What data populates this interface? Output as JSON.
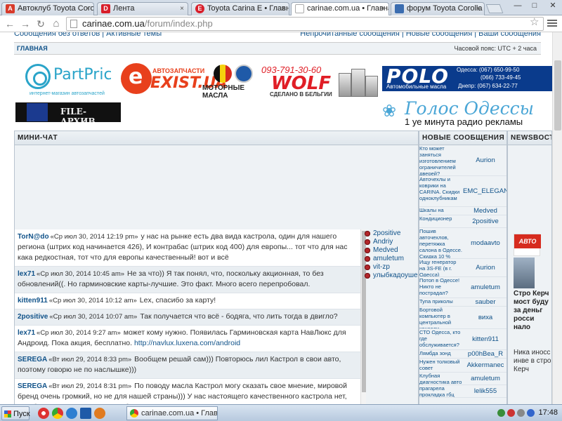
{
  "browser": {
    "tabs": [
      {
        "label": "Автоклуб Toyota Coron",
        "icon_color": "#d83b2b",
        "icon_glyph": "A",
        "active": false
      },
      {
        "label": "Лента",
        "icon_color": "#d81e2a",
        "icon_glyph": "D",
        "active": false
      },
      {
        "label": "Toyota Carina E • Главн",
        "icon_color": "#d81e2a",
        "icon_glyph": "E",
        "active": false
      },
      {
        "label": "carinae.com.ua • Главна",
        "icon_color": "#ffffff",
        "icon_glyph": "",
        "active": true
      },
      {
        "label": "форум Toyota Corolla",
        "icon_color": "#3b6db0",
        "icon_glyph": "",
        "active": false
      }
    ],
    "url_host": "carinae.com.ua",
    "url_path": "/forum/index.php",
    "window_min": "—",
    "window_max": "□",
    "window_close": "✕",
    "tab_close": "×"
  },
  "page": {
    "top_left_links": "Сообщения без ответов | Активные темы",
    "top_right_links": "Непрочитанные сообщения | Новые сообщения | Ваши сообщения",
    "nav_home": "ГЛАВНАЯ",
    "timezone": "Часовой пояс: UTC + 2 часа"
  },
  "banners": {
    "partprice_name": "PartPrice",
    "partprice_tag": "интернет-магазин автозапчастей",
    "exist_sub": "АВТОЗАПЧАСТИ",
    "exist_name": "EXIST.UA",
    "exist_oil": "МОТОРНЫЕ МАСЛА",
    "wolf_phone": "093-791-30-60",
    "wolf_name": "WOLF",
    "wolf_made": "СДЕЛАНО В БЕЛЬГИИ",
    "polo_name": "POLO",
    "polo_tag": "Автомобильные масла",
    "polo_phones": [
      "Одесса: (067) 650-99-50",
      "(066) 733-49-45",
      "Днепр: (067) 634-22-77"
    ],
    "file_archive": "FILE-АРХИВ",
    "golos_title": "Голос Одессы",
    "golos_sub": "1 уе минута радио рекламы"
  },
  "minichat": {
    "header": "МИНИ-ЧАТ",
    "messages": [
      {
        "user": "TorN@do",
        "date": "«Ср июл 30, 2014 12:19 pm»",
        "text": "у нас на рынке есть два вида кастрола, один для нашего региона (штрих код начинается 426), И контрабас (штрих код 400) для европы... тот что для нас кака редкостная, тот что для европы качественный! вот и всё"
      },
      {
        "user": "lex71",
        "date": "«Ср июл 30, 2014 10:45 am»",
        "text": "Не за что)) Я так понял, что, поскольку акционная, то без обновлений((. Но гарминовские карты-лучшие. Это факт. Много всего перепробовал."
      },
      {
        "user": "kitten911",
        "date": "«Ср июл 30, 2014 10:12 am»",
        "text": "Lex, спасибо за карту!"
      },
      {
        "user": "2positive",
        "date": "«Ср июл 30, 2014 10:07 am»",
        "text": "Так получается что всё - бодяга, что лить тогда в двигло?"
      },
      {
        "user": "lex71",
        "date": "«Ср июл 30, 2014 9:27 am»",
        "text": "может кому нужно. Появилась Гарминовская карта НавЛюкс для Андроид. Пока акция, бесплатно.",
        "link": "http://navlux.luxena.com/android"
      },
      {
        "user": "SEREGA",
        "date": "«Вт июл 29, 2014 8:33 pm»",
        "text": "Вообщем решай сам))) Повторюсь лил Кастрол в свои авто, поэтому говорю не по наслышке)))"
      },
      {
        "user": "SEREGA",
        "date": "«Вт июл 29, 2014 8:31 pm»",
        "text": "По поводу масла Кастрол могу сказать свое мнение, мировой бренд очень громкий, но не для нашей страны))) У нас настоящего качественного кастрола нет, сам был поклонником данного бренда, в Каришке при покупке все жидкости залил Кастрол, но со"
      }
    ],
    "online_users": [
      "2positive",
      "Andriy",
      "Medved",
      "amuletum",
      "vit-zp",
      "улыбкадоушей"
    ]
  },
  "new_messages": {
    "header": "НОВЫЕ СООБЩЕНИЯ",
    "rows": [
      {
        "topic": "Кто может заняться изготовлением ограничителей дверей?",
        "author": "Aurion"
      },
      {
        "topic": "Авточехлы и коврики на CARINA. Скидки одноклубникам",
        "author": "EMC_ELEGANT"
      },
      {
        "topic": "Шкалы на приборку",
        "author": "Medved"
      },
      {
        "topic": "Кондиционер",
        "author": "2positive"
      },
      {
        "topic": "Пошив авточехлов, перетяжка салона в Одессе. Скидка 10 %",
        "author": "modaavto"
      },
      {
        "topic": "Ищу генератор на 3S-FE (в г. Одесса)",
        "author": "Aurion"
      },
      {
        "topic": "Потоп в Одессе! Никто не пострадал?",
        "author": "amuletum"
      },
      {
        "topic": "Тупа приколы",
        "author": "sauber"
      },
      {
        "topic": "Бортовой компьютер в центральной консоли.",
        "author": "виха"
      },
      {
        "topic": "СТО Одесса, кто где обслуживается?",
        "author": "kitten911"
      },
      {
        "topic": "Лямбда зонд",
        "author": "p00hBea_R"
      },
      {
        "topic": "Нужен толковый совет",
        "author": "Akkermanec"
      },
      {
        "topic": "Клубная диагностика авто",
        "author": "amuletum"
      },
      {
        "topic": "прагарела прокладка гбц",
        "author": "lelik555"
      }
    ]
  },
  "news": {
    "header": "NEWSВОСТИ",
    "badge": "АВТО",
    "headline": "Стро Керч мост буду за деньг росси нало",
    "text2": "Ника иносс инве в стро Керч"
  },
  "taskbar": {
    "start_label": "Пуск",
    "task_label": "carinae.com.ua • Глав...",
    "clock": "17:48"
  },
  "colors": {
    "link": "#105289",
    "panel_bg": "#eef2f5",
    "online_dot": "#b3262a"
  }
}
